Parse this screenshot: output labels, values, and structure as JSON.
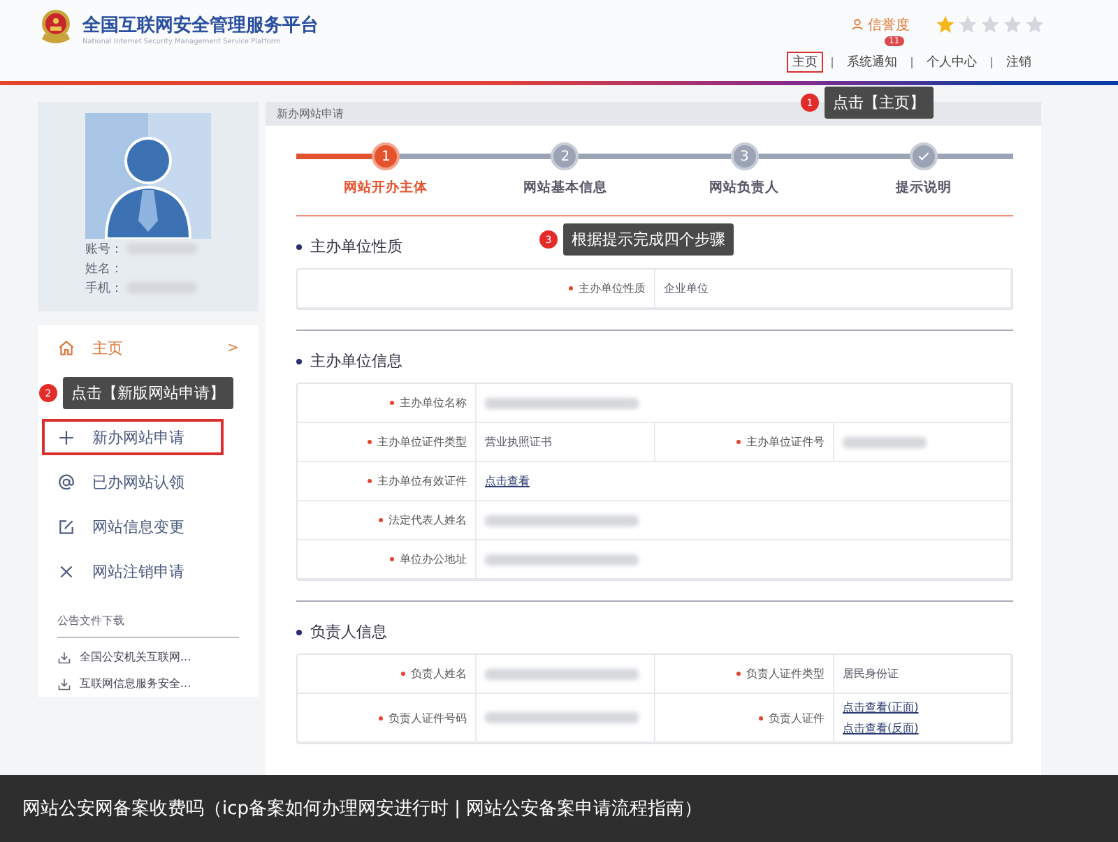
{
  "header": {
    "title": "全国互联网安全管理服务平台",
    "subtitle": "National Internet Security Management Service Platform",
    "credit": {
      "label": "信誉度",
      "stars": 1
    },
    "nav": [
      {
        "label": "主页",
        "highlighted": true
      },
      {
        "label": "系统通知",
        "highlighted": false,
        "badge": "11"
      },
      {
        "label": "个人中心",
        "highlighted": false
      },
      {
        "label": "注销",
        "highlighted": false
      }
    ]
  },
  "profile": {
    "fields": [
      {
        "label": "账号：",
        "redacted": true
      },
      {
        "label": "姓名：",
        "redacted": false
      },
      {
        "label": "手机：",
        "redacted": true
      }
    ]
  },
  "sidebar": {
    "items": [
      {
        "kind": "home",
        "label": "主页",
        "selected": true,
        "highlighted": false,
        "chevron": ">"
      },
      {
        "kind": "plus",
        "label": "新办网站申请",
        "selected": false,
        "highlighted": true
      },
      {
        "kind": "at",
        "label": "已办网站认领",
        "selected": false,
        "highlighted": false
      },
      {
        "kind": "edit",
        "label": "网站信息变更",
        "selected": false,
        "highlighted": false
      },
      {
        "kind": "cross",
        "label": "网站注销申请",
        "selected": false,
        "highlighted": false
      }
    ],
    "downloads": {
      "title": "公告文件下载",
      "items": [
        "全国公安机关互联网...",
        "互联网信息服务安全..."
      ]
    }
  },
  "panel": {
    "title": "新办网站申请",
    "steps": [
      {
        "kind": "number",
        "number": "1",
        "label": "网站开办主体",
        "selected": true
      },
      {
        "kind": "number",
        "number": "2",
        "label": "网站基本信息",
        "selected": false
      },
      {
        "kind": "number",
        "number": "3",
        "label": "网站负责人",
        "selected": false
      },
      {
        "kind": "check",
        "label": "提示说明",
        "selected": false
      }
    ],
    "sections": [
      {
        "title": "主办单位性质",
        "kind": "single",
        "rows": [
          [
            {
              "label": "主办单位性质",
              "kind": "text",
              "value": "企业单位"
            }
          ]
        ]
      },
      {
        "title": "主办单位信息",
        "kind": "table",
        "rows": [
          [
            {
              "label": "主办单位名称",
              "kind": "redacted"
            }
          ],
          [
            {
              "label": "主办单位证件类型",
              "kind": "text",
              "value": "营业执照证书"
            },
            {
              "label": "主办单位证件号",
              "kind": "redacted"
            }
          ],
          [
            {
              "label": "主办单位有效证件",
              "kind": "links",
              "links": [
                "点击查看"
              ]
            }
          ],
          [
            {
              "label": "法定代表人姓名",
              "kind": "redacted"
            }
          ],
          [
            {
              "label": "单位办公地址",
              "kind": "redacted"
            }
          ]
        ]
      },
      {
        "title": "负责人信息",
        "kind": "table",
        "rows": [
          [
            {
              "label": "负责人姓名",
              "kind": "redacted"
            },
            {
              "label": "负责人证件类型",
              "kind": "text",
              "value": "居民身份证"
            }
          ],
          [
            {
              "label": "负责人证件号码",
              "kind": "redacted"
            },
            {
              "label": "负责人证件",
              "kind": "links",
              "links": [
                "点击查看(正面)",
                "点击查看(反面)"
              ]
            }
          ]
        ]
      }
    ]
  },
  "callouts": [
    {
      "number": "1",
      "text": "点击【主页】"
    },
    {
      "number": "2",
      "text": "点击【新版网站申请】"
    },
    {
      "number": "3",
      "text": "根据提示完成四个步骤"
    }
  ],
  "caption": "网站公安网备案收费吗（icp备案如何办理网安进行时 | 网站公安备案申请流程指南）"
}
